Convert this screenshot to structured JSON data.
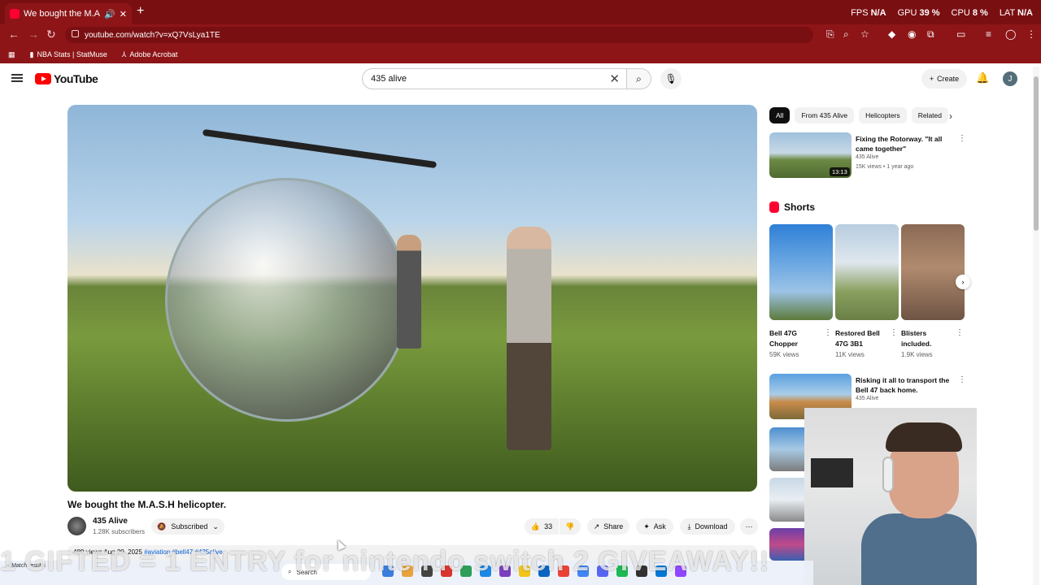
{
  "browser": {
    "tab_title": "We bought the M.A.S.H helicopter.",
    "tab_audio_icon": "speaker-icon",
    "url": "youtube.com/watch?v=xQ7VsLya1TE",
    "perf": {
      "fps_label": "FPS",
      "fps": "N/A",
      "gpu_label": "GPU",
      "gpu": "39 %",
      "cpu_label": "CPU",
      "cpu": "8 %",
      "lat_label": "LAT",
      "lat": "N/A"
    },
    "bookmarks": [
      "NBA Stats | StatMuse",
      "Adobe Acrobat"
    ]
  },
  "youtube": {
    "search_value": "435 alive",
    "create_label": "Create",
    "avatar_letter": "J",
    "video": {
      "title": "We bought the M.A.S.H helicopter.",
      "channel": "435 Alive",
      "subscribers": "1.28K subscribers",
      "subscribed_label": "Subscribed",
      "likes": "33",
      "share_label": "Share",
      "ask_label": "Ask",
      "download_label": "Download",
      "description_meta": "489 views  Aug 20, 2025",
      "description_tags": "#aviation #bell47 #435alive"
    },
    "chips": [
      "All",
      "From 435 Alive",
      "Helicopters",
      "Related"
    ],
    "recommendations": [
      {
        "title": "Fixing the Rotorway. \"It all came together\"",
        "channel": "435 Alive",
        "meta": "15K views • 1 year ago",
        "duration": "13:13"
      },
      {
        "title": "Risking it all to transport the Bell 47 back home.",
        "channel": "435 Alive",
        "meta": ""
      }
    ],
    "shorts_heading": "Shorts",
    "shorts": [
      {
        "title": "Bell 47G Chopper",
        "views": "59K views"
      },
      {
        "title": "Restored Bell 47G 3B1",
        "views": "11K views"
      },
      {
        "title": "Blisters included.",
        "views": "1.9K views"
      }
    ]
  },
  "overlay": {
    "text": "1 GIFTED = 1 ENTRY for nintendo switch 2 GIVEAWAY!!"
  },
  "taskbar": {
    "widget_text": "Match results",
    "search_placeholder": "Search"
  },
  "colors": {
    "chrome_frame": "#7a0f12",
    "youtube_red": "#ff0000",
    "link_blue": "#065fd4"
  }
}
